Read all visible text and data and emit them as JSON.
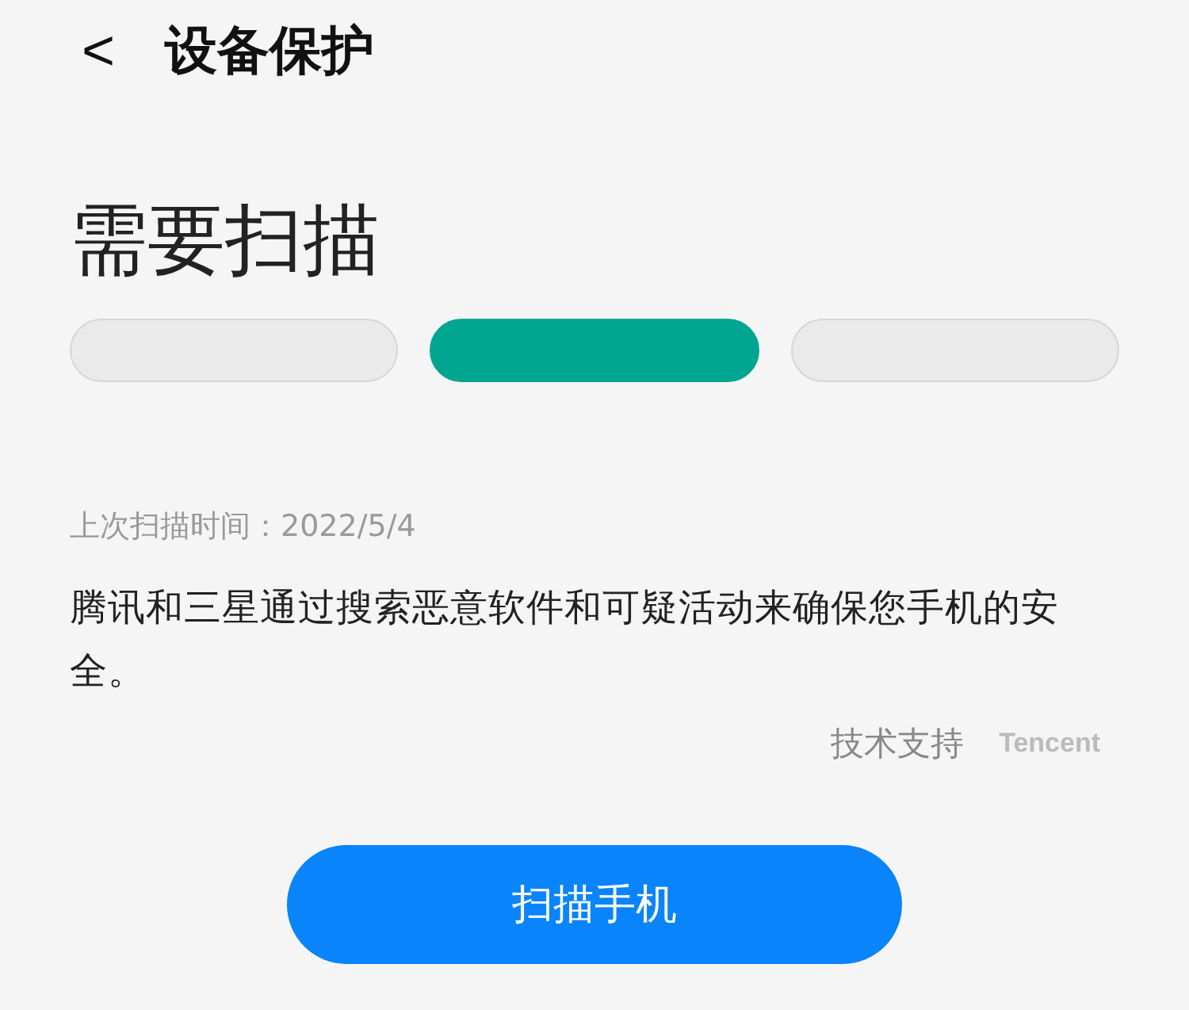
{
  "header": {
    "back": "<",
    "title": "设备保护"
  },
  "status": {
    "title": "需要扫描",
    "segments": [
      {
        "on": false
      },
      {
        "on": true
      },
      {
        "on": false
      }
    ]
  },
  "last_scan": "上次扫描时间：2022/5/4",
  "description": "腾讯和三星通过搜索恶意软件和可疑活动来确保您手机的安全。",
  "support": {
    "label": "技术支持",
    "provider": "Tencent"
  },
  "scan_button": "扫描手机"
}
